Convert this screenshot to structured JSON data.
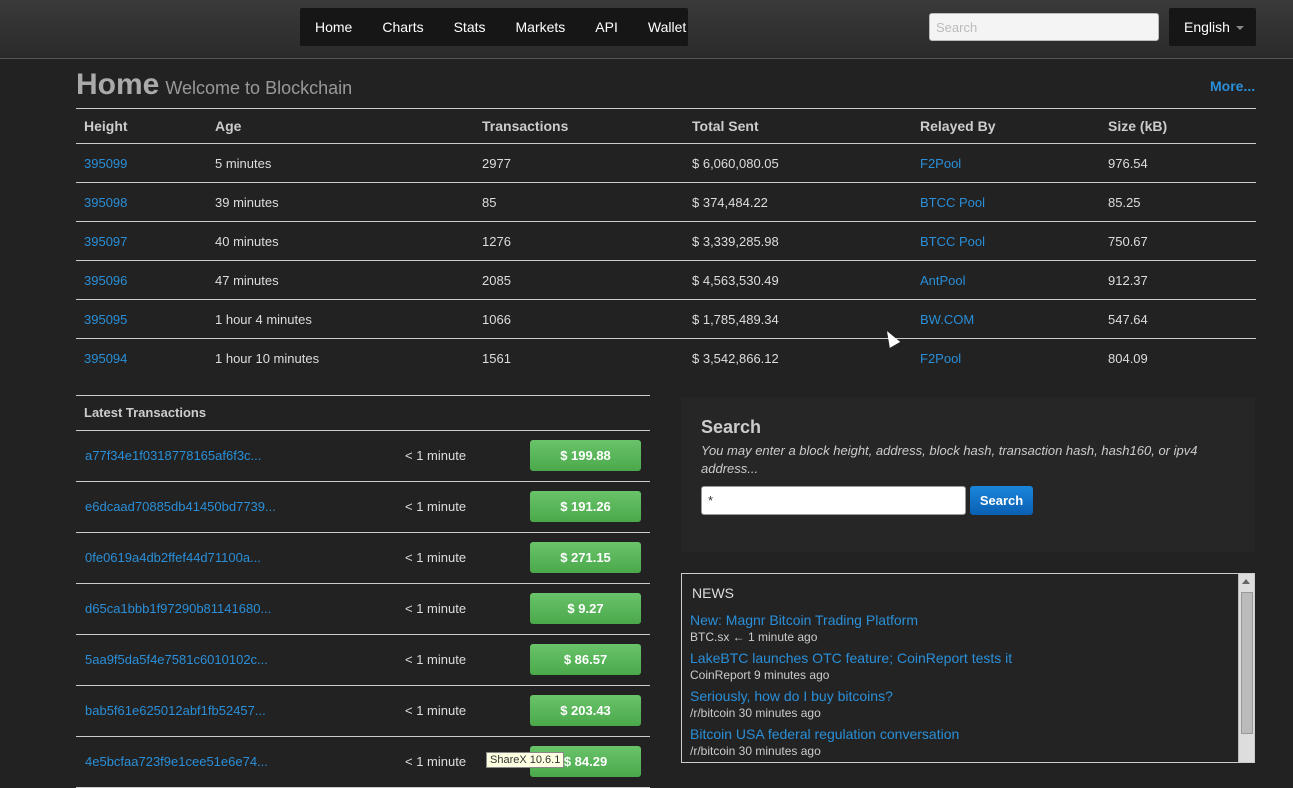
{
  "nav": {
    "items": [
      "Home",
      "Charts",
      "Stats",
      "Markets",
      "API",
      "Wallet"
    ]
  },
  "topbar": {
    "search_placeholder": "Search",
    "language": "English"
  },
  "page": {
    "title": "Home",
    "subtitle": "Welcome to Blockchain",
    "more_link": "More..."
  },
  "blocks": {
    "headers": [
      "Height",
      "Age",
      "Transactions",
      "Total Sent",
      "Relayed By",
      "Size (kB)"
    ],
    "rows": [
      {
        "height": "395099",
        "age": "5 minutes",
        "transactions": "2977",
        "total_sent": "$ 6,060,080.05",
        "relayed_by": "F2Pool",
        "size": "976.54"
      },
      {
        "height": "395098",
        "age": "39 minutes",
        "transactions": "85",
        "total_sent": "$ 374,484.22",
        "relayed_by": "BTCC Pool",
        "size": "85.25"
      },
      {
        "height": "395097",
        "age": "40 minutes",
        "transactions": "1276",
        "total_sent": "$ 3,339,285.98",
        "relayed_by": "BTCC Pool",
        "size": "750.67"
      },
      {
        "height": "395096",
        "age": "47 minutes",
        "transactions": "2085",
        "total_sent": "$ 4,563,530.49",
        "relayed_by": "AntPool",
        "size": "912.37"
      },
      {
        "height": "395095",
        "age": "1 hour 4 minutes",
        "transactions": "1066",
        "total_sent": "$ 1,785,489.34",
        "relayed_by": "BW.COM",
        "size": "547.64"
      },
      {
        "height": "395094",
        "age": "1 hour 10 minutes",
        "transactions": "1561",
        "total_sent": "$ 3,542,866.12",
        "relayed_by": "F2Pool",
        "size": "804.09"
      }
    ]
  },
  "latest_transactions": {
    "title": "Latest Transactions",
    "rows": [
      {
        "hash": "a77f34e1f0318778165af6f3c...",
        "age": "< 1 minute",
        "amount": "$ 199.88"
      },
      {
        "hash": "e6dcaad70885db41450bd7739...",
        "age": "< 1 minute",
        "amount": "$ 191.26"
      },
      {
        "hash": "0fe0619a4db2ffef44d71100a...",
        "age": "< 1 minute",
        "amount": "$ 271.15"
      },
      {
        "hash": "d65ca1bbb1f97290b81141680...",
        "age": "< 1 minute",
        "amount": "$ 9.27"
      },
      {
        "hash": "5aa9f5da5f4e7581c6010102c...",
        "age": "< 1 minute",
        "amount": "$ 86.57"
      },
      {
        "hash": "bab5f61e625012abf1fb52457...",
        "age": "< 1 minute",
        "amount": "$ 203.43"
      },
      {
        "hash": "4e5bcfaa723f9e1cee51e6e74...",
        "age": "< 1 minute",
        "amount": "$ 84.29"
      }
    ]
  },
  "search_panel": {
    "title": "Search",
    "description": "You may enter a block height, address, block hash, transaction hash, hash160, or ipv4 address...",
    "input_value": "*",
    "button": "Search"
  },
  "news": {
    "title": "NEWS",
    "items": [
      {
        "title": "New: Magnr Bitcoin Trading Platform",
        "source": "BTC.sx ← 1 minute ago"
      },
      {
        "title": "LakeBTC launches OTC feature; CoinReport tests it",
        "source": "CoinReport 9 minutes ago"
      },
      {
        "title": "Seriously, how do I buy bitcoins?",
        "source": "/r/bitcoin 30 minutes ago"
      },
      {
        "title": "Bitcoin USA federal regulation conversation",
        "source": "/r/bitcoin 30 minutes ago"
      }
    ]
  },
  "tooltip": "ShareX 10.6.1"
}
